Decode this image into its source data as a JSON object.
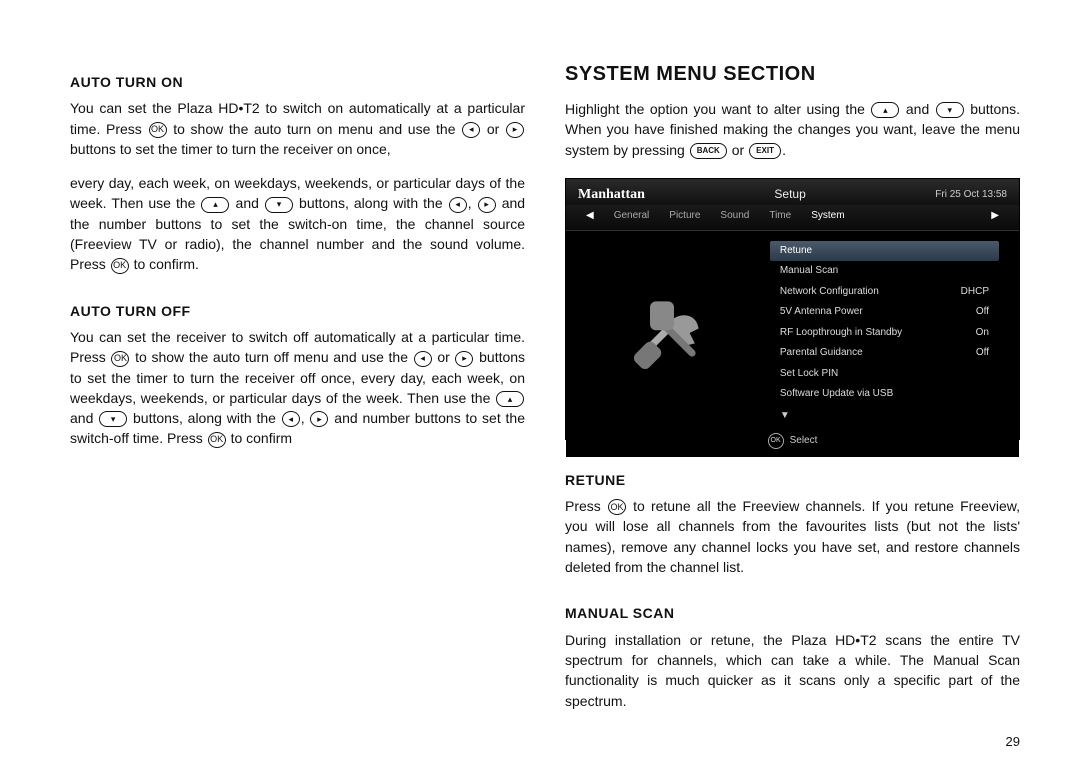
{
  "page_number": "29",
  "left": {
    "h_auto_on": "AUTO TURN ON",
    "p_auto_on_1": "You can set the Plaza HD•T2 to switch on automatically at a particular time. Press",
    "p_auto_on_1b": "to show the auto turn on menu and use the",
    "p_auto_on_1c": "or",
    "p_auto_on_1d": "buttons to set the timer to turn the receiver on once,",
    "p_auto_on_2a": "every day, each week, on weekdays, weekends, or particular days of the week. Then use the",
    "p_auto_on_2b": "and",
    "p_auto_on_2c": "buttons, along with the",
    "p_auto_on_2d": ",",
    "p_auto_on_2e": "and the number buttons to set the switch-on time, the channel source (Freeview TV or radio), the channel number and the sound volume. Press",
    "p_auto_on_2f": "to confirm.",
    "h_auto_off": "AUTO TURN OFF",
    "p_auto_off_a": "You can set the receiver to switch off automatically at a particular time. Press",
    "p_auto_off_b": "to show the auto turn off menu and use the",
    "p_auto_off_c": "or",
    "p_auto_off_d": "buttons to set the timer to turn the receiver off once, every day, each week, on weekdays, weekends, or particular days of the week. Then use the",
    "p_auto_off_e": "and",
    "p_auto_off_f": "buttons, along with the",
    "p_auto_off_g": ",",
    "p_auto_off_h": "and number buttons to set the switch-off time.  Press",
    "p_auto_off_i": "to confirm"
  },
  "right": {
    "h_section": "SYSTEM MENU SECTION",
    "intro_a": "Highlight the option you want to alter using the",
    "intro_b": "and",
    "intro_c": "buttons. When you have finished making the changes you want, leave the menu system by pressing",
    "intro_d": "or",
    "intro_e": ".",
    "h_retune": "RETUNE",
    "p_retune_a": "Press",
    "p_retune_b": "to retune all the Freeview channels. If you retune Freeview, you will lose all channels from the favourites lists (but not the lists' names), remove any channel locks you have set, and restore  channels deleted from the channel list.",
    "h_manual": "MANUAL SCAN",
    "p_manual": "During installation or retune, the Plaza HD•T2 scans the entire TV spectrum for channels, which can take a while. The Manual Scan functionality is much quicker as it scans only a specific part of the spectrum."
  },
  "btn": {
    "ok": "OK",
    "back": "BACK",
    "exit": "EXIT",
    "left": "◂",
    "right": "▸",
    "up": "▴",
    "down": "▾"
  },
  "shot": {
    "brand": "Manhattan",
    "title": "Setup",
    "time": "Fri 25 Oct 13:58",
    "tabs": [
      "General",
      "Picture",
      "Sound",
      "Time",
      "System"
    ],
    "arrow_l": "◀",
    "arrow_r": "▶",
    "down_arrow": "▼",
    "menu": [
      {
        "label": "Retune",
        "value": "",
        "sel": true
      },
      {
        "label": "Manual Scan",
        "value": ""
      },
      {
        "label": "Network Configuration",
        "value": "DHCP"
      },
      {
        "label": "5V Antenna Power",
        "value": "Off"
      },
      {
        "label": "RF Loopthrough in Standby",
        "value": "On"
      },
      {
        "label": "Parental Guidance",
        "value": "Off"
      },
      {
        "label": "Set Lock PIN",
        "value": ""
      },
      {
        "label": "Software Update via USB",
        "value": ""
      }
    ],
    "foot_ok": "OK",
    "foot_select": "Select"
  }
}
